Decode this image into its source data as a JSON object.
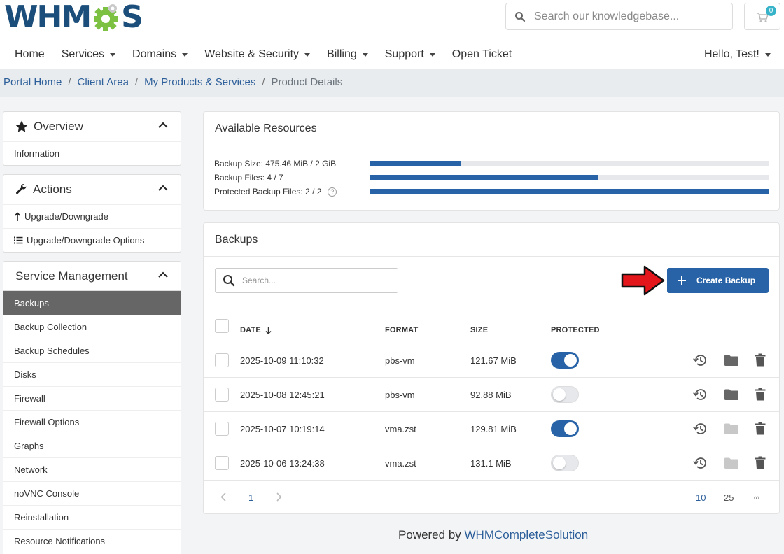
{
  "header": {
    "logo_text": "WHMCS",
    "search_placeholder": "Search our knowledgebase...",
    "cart_count": "0",
    "nav": [
      {
        "label": "Home",
        "has_caret": false
      },
      {
        "label": "Services",
        "has_caret": true
      },
      {
        "label": "Domains",
        "has_caret": true
      },
      {
        "label": "Website & Security",
        "has_caret": true
      },
      {
        "label": "Billing",
        "has_caret": true
      },
      {
        "label": "Support",
        "has_caret": true
      },
      {
        "label": "Open Ticket",
        "has_caret": false
      }
    ],
    "user_greeting": "Hello, Test!"
  },
  "breadcrumb": {
    "items": [
      "Portal Home",
      "Client Area",
      "My Products & Services"
    ],
    "current": "Product Details",
    "separator": "/"
  },
  "sidebar": {
    "overview": {
      "title": "Overview",
      "items": [
        "Information"
      ]
    },
    "actions": {
      "title": "Actions",
      "items": [
        "Upgrade/Downgrade",
        "Upgrade/Downgrade Options"
      ]
    },
    "service_management": {
      "title": "Service Management",
      "active": "Backups",
      "items": [
        "Backups",
        "Backup Collection",
        "Backup Schedules",
        "Disks",
        "Firewall",
        "Firewall Options",
        "Graphs",
        "Network",
        "noVNC Console",
        "Reinstallation",
        "Resource Notifications"
      ]
    }
  },
  "resources": {
    "title": "Available Resources",
    "rows": [
      {
        "label": "Backup Size: 475.46 MiB / 2 GiB",
        "fraction": 0.23
      },
      {
        "label": "Backup Files: 4 / 7",
        "fraction": 0.571
      },
      {
        "label": "Protected Backup Files: 2 / 2",
        "fraction": 1.0,
        "help": "?"
      }
    ]
  },
  "backups": {
    "title": "Backups",
    "search_placeholder": "Search...",
    "create_label": "Create Backup",
    "columns": {
      "date": "DATE",
      "format": "FORMAT",
      "size": "SIZE",
      "protected": "PROTECTED"
    },
    "rows": [
      {
        "date": "2025-10-09 11:10:32",
        "format": "pbs-vm",
        "size": "121.67 MiB",
        "protected": true,
        "browse_enabled": true
      },
      {
        "date": "2025-10-08 12:45:21",
        "format": "pbs-vm",
        "size": "92.88 MiB",
        "protected": false,
        "browse_enabled": true
      },
      {
        "date": "2025-10-07 10:19:14",
        "format": "vma.zst",
        "size": "129.81 MiB",
        "protected": true,
        "browse_enabled": false
      },
      {
        "date": "2025-10-06 13:24:38",
        "format": "vma.zst",
        "size": "131.1 MiB",
        "protected": false,
        "browse_enabled": false
      }
    ],
    "pagination": {
      "current_page": "1",
      "page_sizes": [
        "10",
        "25",
        "∞"
      ],
      "selected_size": "10"
    }
  },
  "footer": {
    "prefix": "Powered by ",
    "link": "WHMCompleteSolution"
  },
  "colors": {
    "brand": "#1b4e7a",
    "accent": "#2763a6",
    "gear": "#7cc142",
    "link": "#2d5f9a"
  }
}
